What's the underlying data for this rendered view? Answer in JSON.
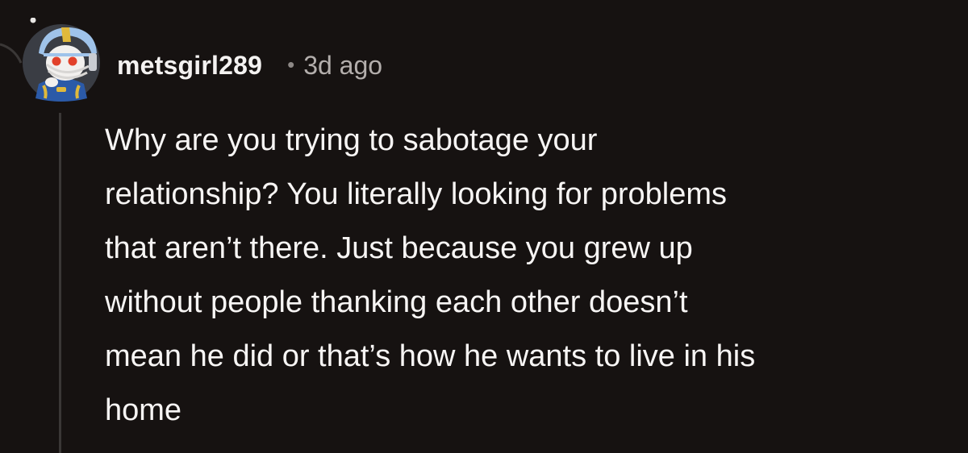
{
  "comment": {
    "username": "metsgirl289",
    "separator": "•",
    "timestamp": "3d ago",
    "lines": [
      "Why are you trying to sabotage your",
      "relationship? You literally looking for problems",
      "that aren’t there. Just because you grew up",
      "without people thanking each other doesn’t",
      "mean he did or that’s how he wants to live in his",
      "home"
    ],
    "avatar_icon": "helmeted-snoo-avatar-icon"
  },
  "colors": {
    "background": "#161211",
    "username": "#f4f2f1",
    "timestamp": "#b3aeac",
    "body_text": "#f7f5f4",
    "thread_line": "#3a3736"
  }
}
